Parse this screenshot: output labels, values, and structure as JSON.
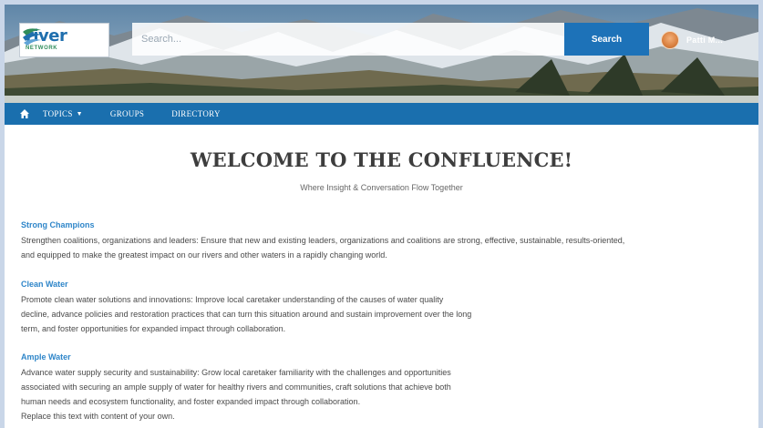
{
  "header": {
    "logo": {
      "word": "river",
      "sub": "NETWORK",
      "tagline": ""
    },
    "search": {
      "placeholder": "Search...",
      "button_label": "Search"
    },
    "user": {
      "name": "Patti M..."
    }
  },
  "nav": {
    "items": [
      {
        "label": "TOPICS",
        "has_dropdown": true
      },
      {
        "label": "GROUPS",
        "has_dropdown": false
      },
      {
        "label": "DIRECTORY",
        "has_dropdown": false
      }
    ]
  },
  "main": {
    "title": "WELCOME TO THE CONFLUENCE!",
    "subtitle": "Where Insight & Conversation Flow Together",
    "sections": [
      {
        "heading": "Strong Champions",
        "lines": [
          "Strengthen coalitions, organizations and leaders: Ensure that new and existing leaders, organizations and coalitions are strong, effective, sustainable, results-oriented,",
          "and equipped to make the greatest impact on our rivers and other waters in a rapidly changing world."
        ]
      },
      {
        "heading": "Clean Water",
        "lines": [
          "Promote clean water solutions and innovations: Improve local caretaker understanding of the causes of water quality",
          "decline, advance policies and restoration practices that can turn this situation around and sustain improvement over the long",
          "term, and foster opportunities for expanded impact through collaboration."
        ]
      },
      {
        "heading": "Ample Water",
        "lines": [
          "Advance water supply security and sustainability: Grow local caretaker familiarity with the challenges and opportunities",
          "associated with securing an ample supply of water for healthy rivers and communities, craft solutions that achieve both",
          "human needs and ecosystem functionality, and foster expanded impact through collaboration.",
          "Replace this text with content of your own."
        ]
      }
    ]
  },
  "colors": {
    "accent": "#1d72b8",
    "nav_background": "#1a6fae",
    "heading_link": "#2f86c9",
    "body_text": "#4a4a4a"
  },
  "icons": {
    "home": "home-icon",
    "dropdown": "chevron-down-icon",
    "logo_mark": "river-logo-icon"
  }
}
